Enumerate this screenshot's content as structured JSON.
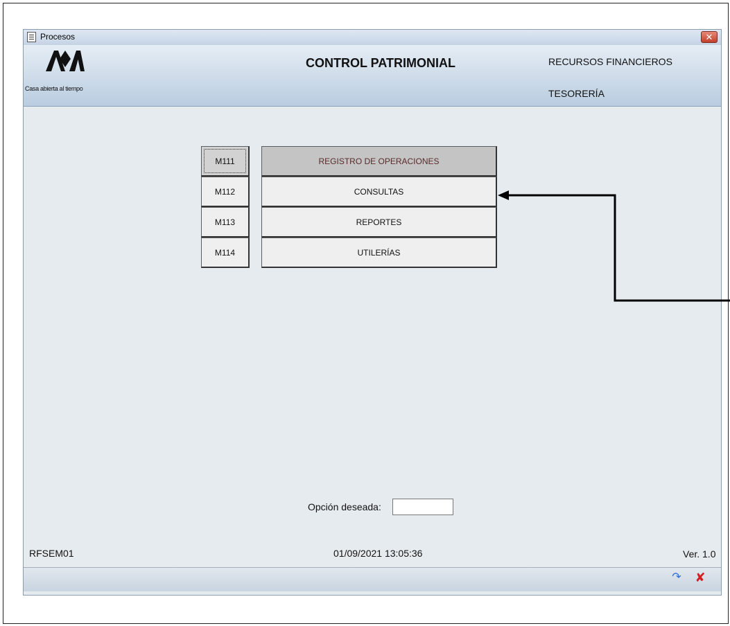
{
  "window": {
    "title": "Procesos",
    "close_glyph": "✕"
  },
  "header": {
    "logo_text": "Casa abierta al tiempo",
    "title": "CONTROL PATRIMONIAL",
    "right_line1": "RECURSOS FINANCIEROS",
    "right_line2": "TESORERÍA"
  },
  "menu": {
    "items": [
      {
        "code": "M111",
        "label": "REGISTRO DE OPERACIONES",
        "selected": true
      },
      {
        "code": "M112",
        "label": "CONSULTAS",
        "selected": false
      },
      {
        "code": "M113",
        "label": "REPORTES",
        "selected": false
      },
      {
        "code": "M114",
        "label": "UTILERÍAS",
        "selected": false
      }
    ]
  },
  "option": {
    "label": "Opción deseada:",
    "value": ""
  },
  "footer": {
    "form_id": "RFSEM01",
    "datetime": "01/09/2021 13:05:36",
    "version": "Ver. 1.0"
  },
  "status_icons": {
    "refresh": "refresh-icon",
    "close": "close-icon"
  },
  "colors": {
    "accent_close": "#d31f1f",
    "refresh": "#2f6fd0"
  }
}
